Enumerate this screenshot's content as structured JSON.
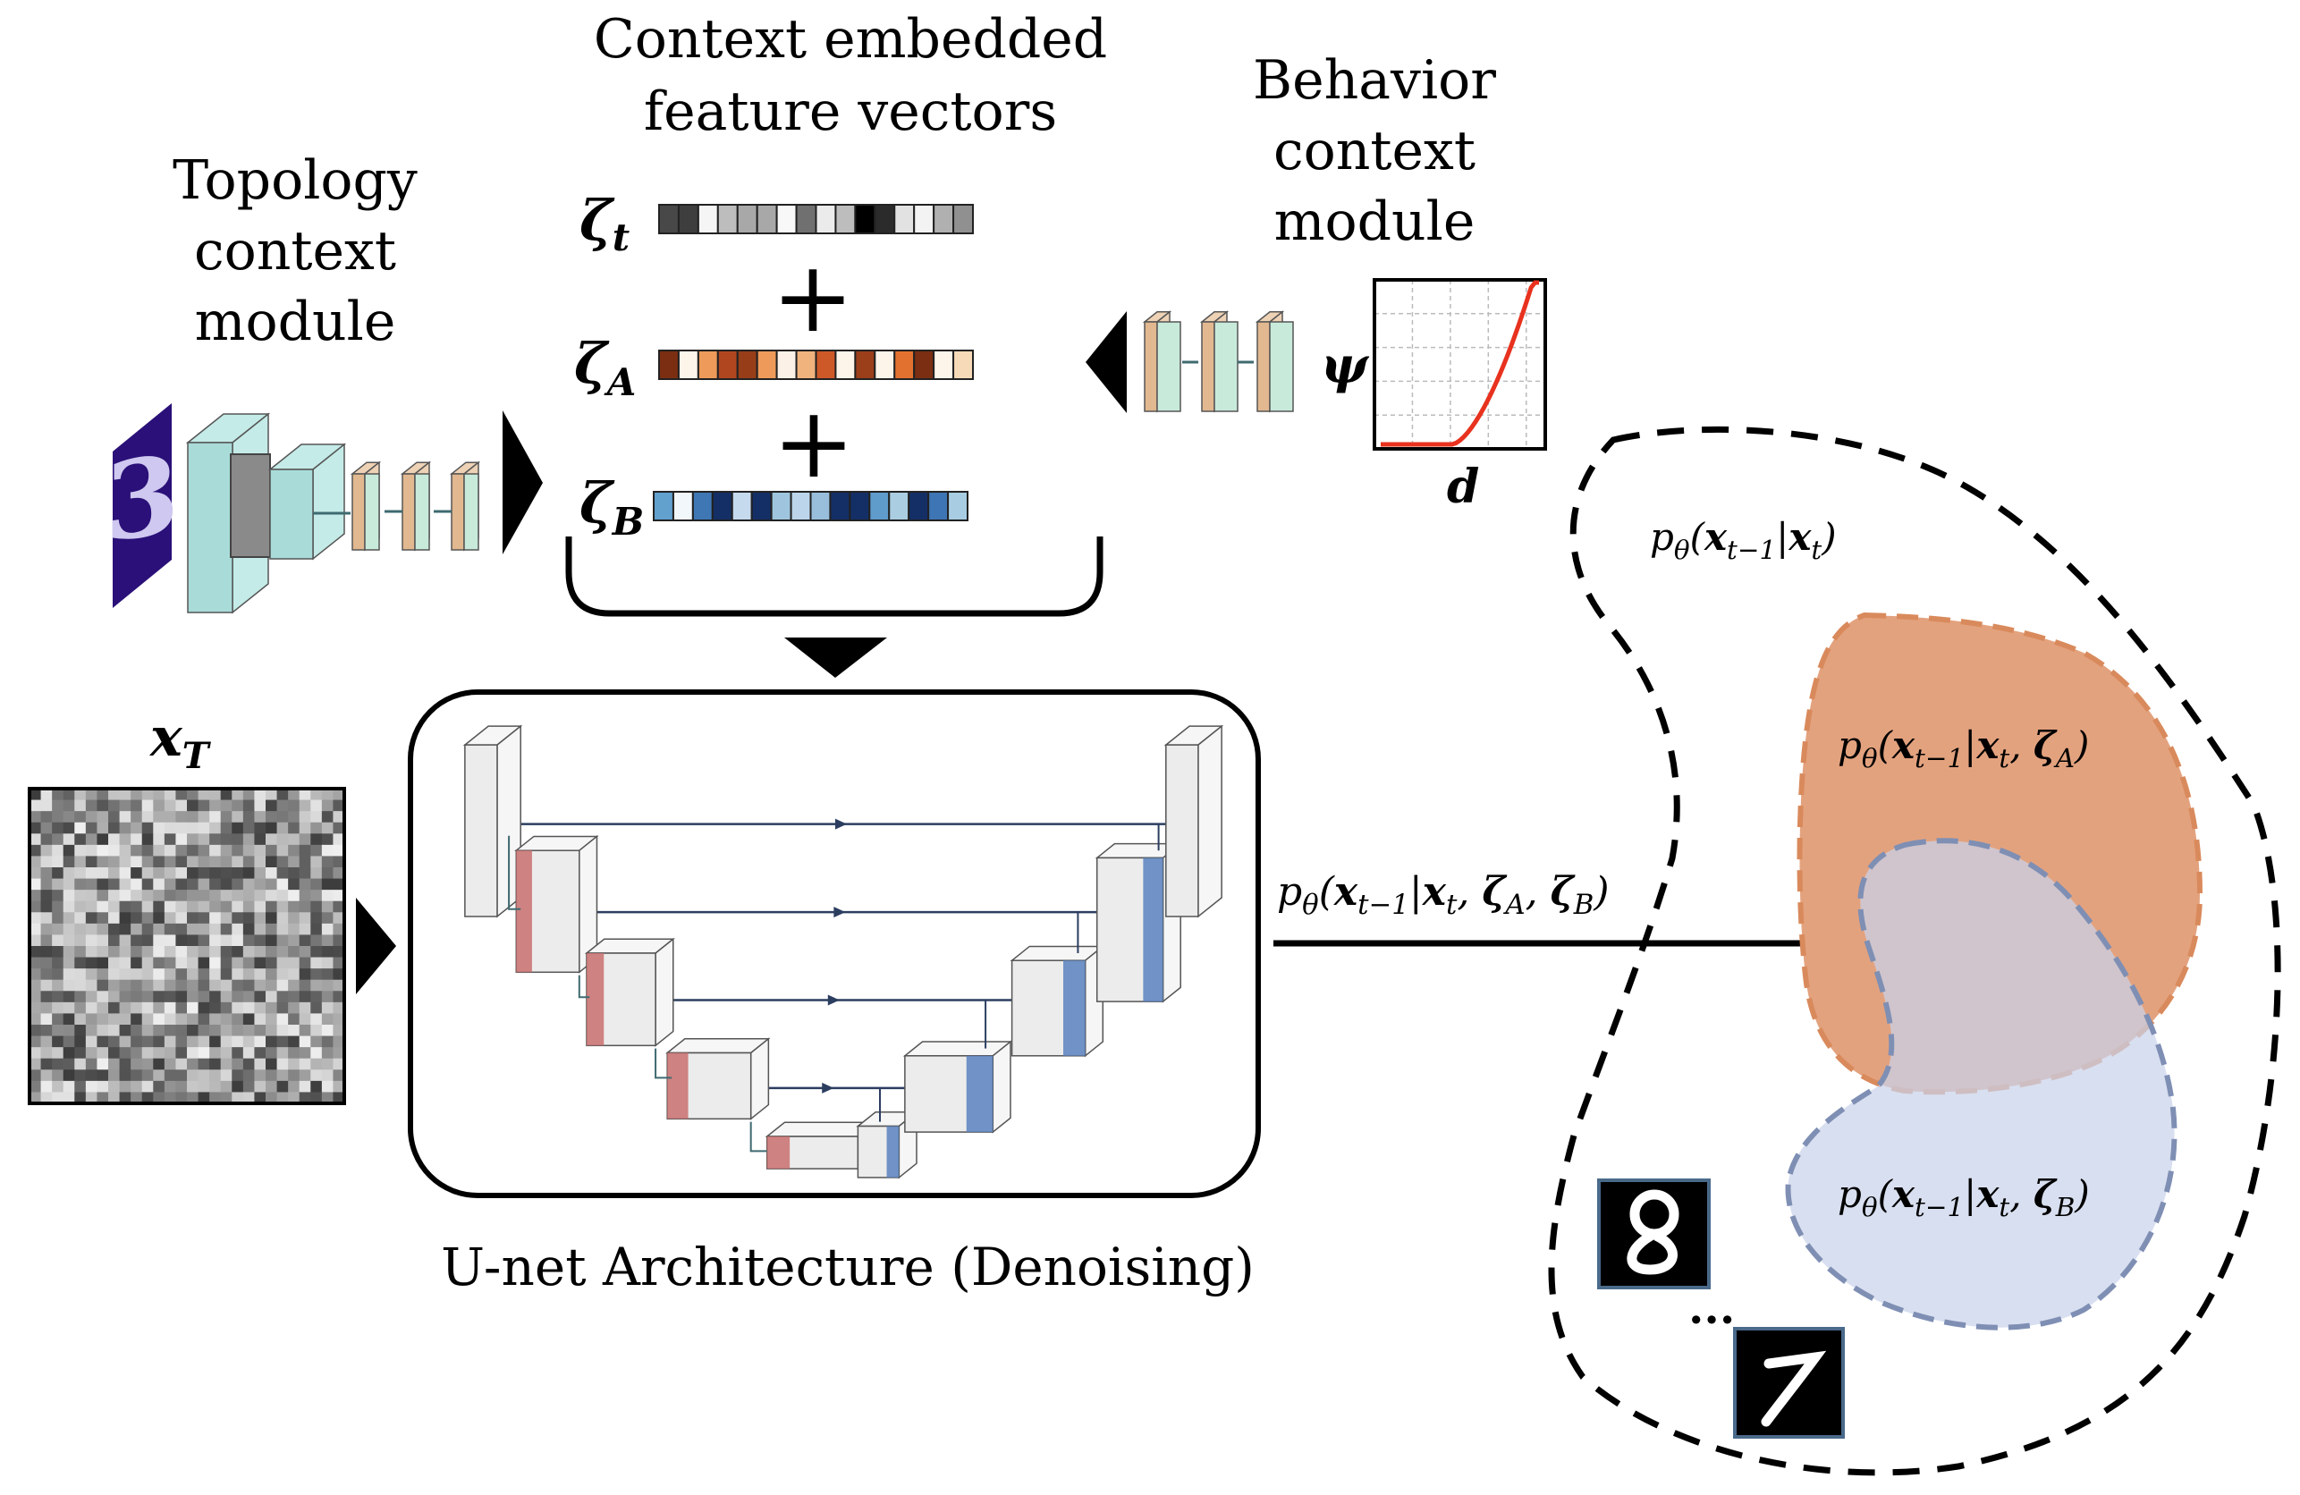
{
  "titles": {
    "context_vectors": [
      "Context embedded",
      "feature vectors"
    ],
    "topology_module": [
      "Topology",
      "context",
      "module"
    ],
    "behavior_module": [
      "Behavior",
      "context",
      "module"
    ],
    "unet": "U-net Architecture (Denoising)"
  },
  "symbols": {
    "zeta": "ζ",
    "zeta_t_sub": "t",
    "zeta_A_sub": "A",
    "zeta_B_sub": "B",
    "plus": "+",
    "psi": "ψ",
    "d": "d",
    "xT": "x",
    "xT_sub": "T",
    "ellipsis": "..."
  },
  "vectors": {
    "zeta_t": [
      "#484848",
      "#3e3e3e",
      "#f5f5f5",
      "#bdbdbd",
      "#a8a8a8",
      "#a8a8a8",
      "#f8f8f8",
      "#707070",
      "#ebebeb",
      "#bdbdbd",
      "#000000",
      "#2b2b2b",
      "#e2e2e2",
      "#f3f3f3",
      "#b0b0b0",
      "#909090"
    ],
    "zeta_A": [
      "#7b2e12",
      "#fdf4ea",
      "#ee9a5a",
      "#b0461f",
      "#973e19",
      "#ee9a5a",
      "#fcf1e6",
      "#f0b37e",
      "#cd5828",
      "#fdf4ea",
      "#9b3e1a",
      "#fdf4ea",
      "#e2712f",
      "#7b2e12",
      "#fdf4ea",
      "#f7dbb8"
    ],
    "zeta_B": [
      "#62a0ce",
      "#f2f7fc",
      "#3f77b5",
      "#142f66",
      "#c6daee",
      "#142f66",
      "#9ec5dd",
      "#bcd5ea",
      "#98bedc",
      "#142f66",
      "#142f66",
      "#5f9bcb",
      "#aacde2",
      "#142f66",
      "#3e75b4",
      "#a8cce1"
    ]
  },
  "formulas": {
    "arrow_label": [
      [
        "p",
        ""
      ],
      [
        "θ",
        "sub"
      ],
      [
        "(",
        ""
      ],
      [
        "x",
        "b"
      ],
      [
        "t−1",
        "sub"
      ],
      [
        "|",
        ""
      ],
      [
        "x",
        "b"
      ],
      [
        "t",
        "sub"
      ],
      [
        ", ",
        ""
      ],
      [
        "ζ",
        "b"
      ],
      [
        "A",
        "sub"
      ],
      [
        ", ",
        ""
      ],
      [
        "ζ",
        "b"
      ],
      [
        "B",
        "sub"
      ],
      [
        ")",
        ""
      ]
    ],
    "marginal": [
      [
        "p",
        ""
      ],
      [
        "θ",
        "sub"
      ],
      [
        "(",
        ""
      ],
      [
        "x",
        "b"
      ],
      [
        "t−1",
        "sub"
      ],
      [
        "|",
        ""
      ],
      [
        "x",
        "b"
      ],
      [
        "t",
        "sub"
      ],
      [
        ")",
        ""
      ]
    ],
    "cond_A": [
      [
        "p",
        ""
      ],
      [
        "θ",
        "sub"
      ],
      [
        "(",
        ""
      ],
      [
        "x",
        "b"
      ],
      [
        "t−1",
        "sub"
      ],
      [
        "|",
        ""
      ],
      [
        "x",
        "b"
      ],
      [
        "t",
        "sub"
      ],
      [
        ", ",
        ""
      ],
      [
        "ζ",
        "b"
      ],
      [
        "A",
        "sub"
      ],
      [
        ")",
        ""
      ]
    ],
    "cond_B": [
      [
        "p",
        ""
      ],
      [
        "θ",
        "sub"
      ],
      [
        "(",
        ""
      ],
      [
        "x",
        "b"
      ],
      [
        "t−1",
        "sub"
      ],
      [
        "|",
        ""
      ],
      [
        "x",
        "b"
      ],
      [
        "t",
        "sub"
      ],
      [
        ", ",
        ""
      ],
      [
        "ζ",
        "b"
      ],
      [
        "B",
        "sub"
      ],
      [
        ")",
        ""
      ]
    ]
  },
  "colors": {
    "region_A": "#e3a27e",
    "region_A_edge": "#d98a5c",
    "region_B": "#c9d3ea",
    "region_B_edge": "#7f8fb4",
    "curve": "#e8321e",
    "teal": "#a9dcd8",
    "orange_layer": "#e2b890",
    "green_layer": "#c8eadb",
    "digit_bg": "#2a1078"
  }
}
